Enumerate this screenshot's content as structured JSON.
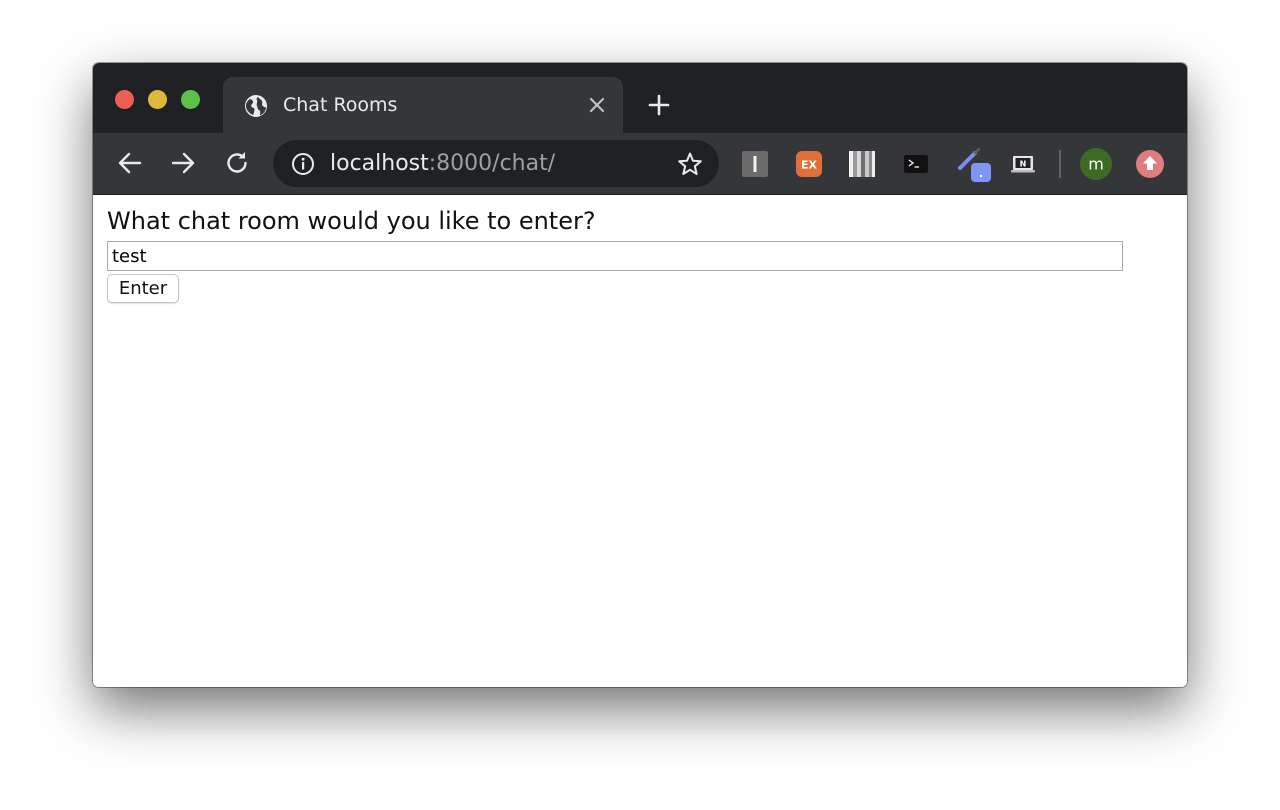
{
  "browser": {
    "tab": {
      "title": "Chat Rooms"
    },
    "url": {
      "host": "localhost",
      "rest": ":8000/chat/"
    },
    "profile_initial": "m"
  },
  "extensions": [
    {
      "name": "instapaper-extension",
      "label": "I",
      "color": "#6b6b6b"
    },
    {
      "name": "ex-extension",
      "label": "EX",
      "color": "#e0703a"
    },
    {
      "name": "barcode-extension",
      "label": "",
      "color": "#bdbdbd"
    },
    {
      "name": "terminal-extension",
      "label": ">_",
      "color": "#111111"
    },
    {
      "name": "pen-extension",
      "label": ".",
      "color": "#7b8cf0"
    },
    {
      "name": "notion-extension",
      "label": "N",
      "color": "#e6e6e6"
    }
  ],
  "page": {
    "prompt": "What chat room would you like to enter?",
    "room_input_value": "test",
    "enter_label": "Enter"
  },
  "colors": {
    "titlebar": "#202124",
    "tab": "#35363a",
    "profile": "#3d6b25",
    "update": "#e07d7d"
  }
}
